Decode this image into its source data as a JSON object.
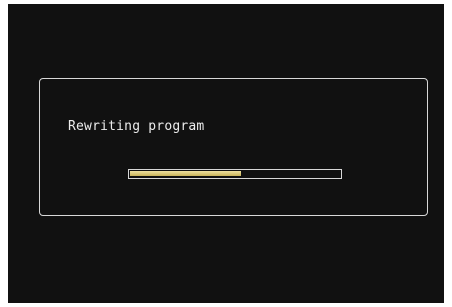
{
  "dialog": {
    "message": "Rewriting program",
    "progress": 0.53
  }
}
